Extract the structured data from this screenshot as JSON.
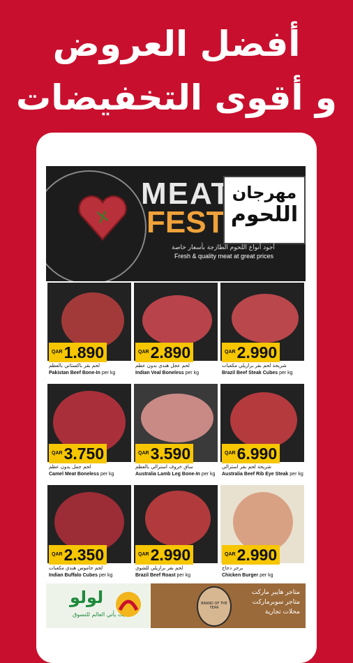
{
  "headline": {
    "line1": "أفضل العروض",
    "line2": "و أقوى التخفيضات"
  },
  "banner": {
    "meat": "MEAT",
    "fest": "FEST",
    "arabic_title_1": "مهرجان",
    "arabic_title_2": "اللحوم",
    "tagline_ar": "أجود أنواع اللحوم الطازجة بأسعار خاصة",
    "tagline_en": "Fresh & quality meat at great prices"
  },
  "currency": "QAR",
  "unit": "per kg",
  "products": [
    {
      "price": "1.890",
      "name_ar": "لحم بقر باكستاني بالعظم",
      "name_en": "Pakistan Beef Bone-In",
      "color": "#a33a3a"
    },
    {
      "price": "2.890",
      "name_ar": "لحم عجل هندي بدون عظم",
      "name_en": "Indian Veal Boneless",
      "color": "#b8434a"
    },
    {
      "price": "2.990",
      "name_ar": "شريحة لحم بقر برازيلي مكعبات",
      "name_en": "Brazil Beef Steak Cubes",
      "color": "#b9474c"
    },
    {
      "price": "3.750",
      "name_ar": "لحم جمل بدون عظم",
      "name_en": "Camel Meat Boneless",
      "color": "#a9303a"
    },
    {
      "price": "3.590",
      "name_ar": "ساق خروف استرالي بالعظم",
      "name_en": "Australia Lamb Leg Bone-In",
      "color": "#c98a86"
    },
    {
      "price": "6.990",
      "name_ar": "شريحة لحم بقر استرالي",
      "name_en": "Australia Beef Rib Eye Steak",
      "color": "#b53a3e"
    },
    {
      "price": "2.350",
      "name_ar": "لحم جاموس هندي مكعبات",
      "name_en": "Indian Buffalo Cubes",
      "color": "#9c2c36"
    },
    {
      "price": "2.990",
      "name_ar": "لحم بقر برازيلي للشوي",
      "name_en": "Brazil Beef Roast",
      "color": "#b13a3c"
    },
    {
      "price": "2.990",
      "name_ar": "برجر دجاج",
      "name_en": "Chicken Burger",
      "color": "#d9a184"
    }
  ],
  "footer": {
    "lulu_logo": "لولو",
    "lulu_tagline": "حيث يأتي العالم للتسوق",
    "seal_text": "BRAND OF THE YEAR",
    "store_types": [
      "متاجر هايبر ماركت",
      "متاجر سوبرماركت",
      "محلات تجارية"
    ]
  }
}
